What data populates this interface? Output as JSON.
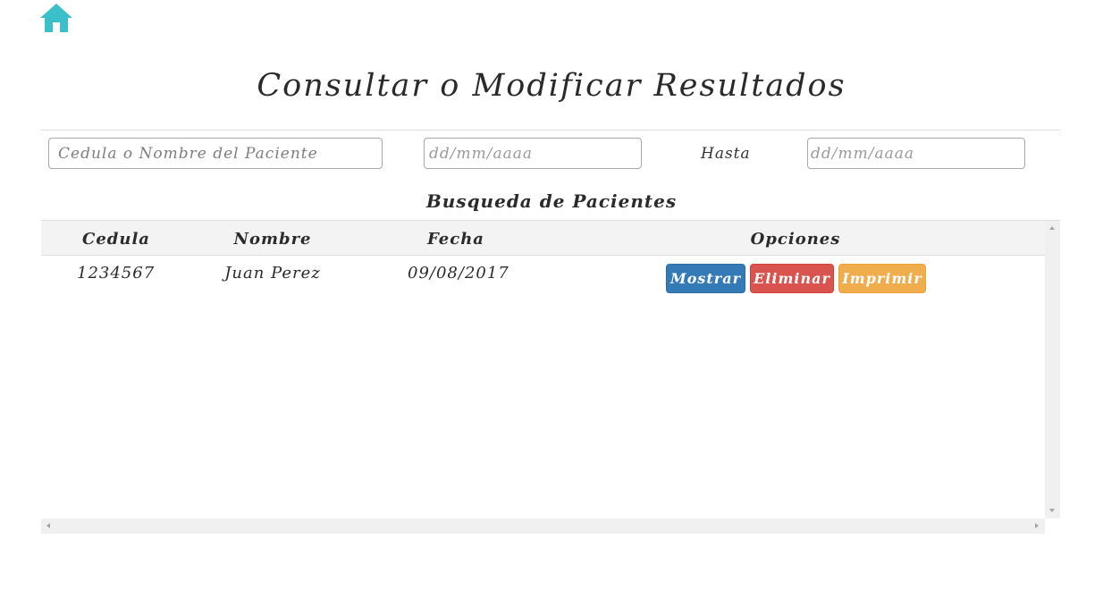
{
  "nav": {
    "home_icon": "home-icon",
    "home_color": "#3bbfc8"
  },
  "page_title": "Consultar o Modificar Resultados",
  "filters": {
    "search_placeholder": "Cedula o Nombre del Paciente",
    "search_value": "",
    "date_from_placeholder": "dd/mm/aaaa",
    "date_from_value": "",
    "hasta_label": "Hasta",
    "date_to_placeholder": "dd/mm/aaaa",
    "date_to_value": ""
  },
  "section_title": "Busqueda de Pacientes",
  "table": {
    "columns": [
      "Cedula",
      "Nombre",
      "Fecha",
      "Opciones"
    ],
    "rows": [
      {
        "cedula": "1234567",
        "nombre": "Juan Perez",
        "fecha": "09/08/2017"
      }
    ],
    "actions": {
      "show": "Mostrar",
      "delete": "Eliminar",
      "print": "Imprimir"
    }
  },
  "colors": {
    "primary": "#337ab7",
    "danger": "#d9534f",
    "warning": "#f0ad4e"
  }
}
